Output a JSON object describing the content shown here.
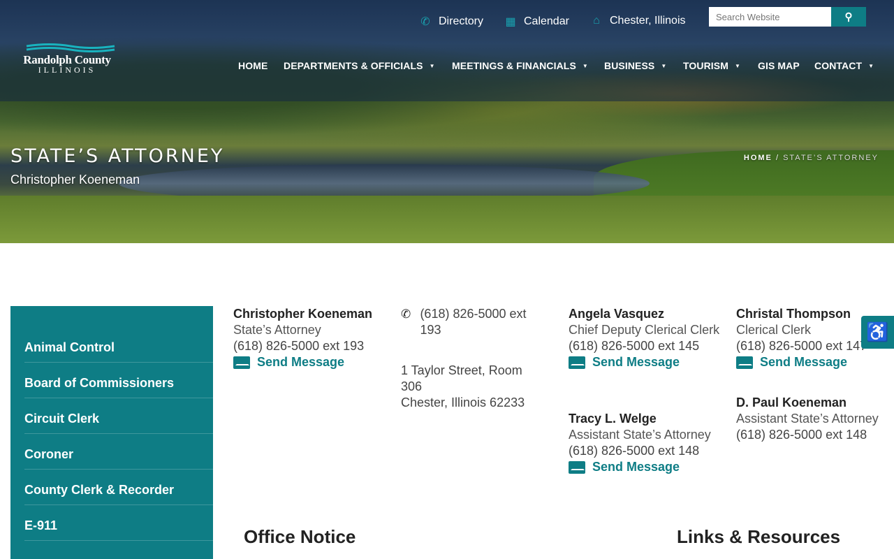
{
  "logo": {
    "name": "Randolph County",
    "state": "ILLINOIS"
  },
  "utility": [
    {
      "icon": "phone-icon",
      "glyph": "📞",
      "label": "Directory"
    },
    {
      "icon": "calendar-icon",
      "glyph": "▦",
      "label": "Calendar"
    },
    {
      "icon": "courthouse-icon",
      "glyph": "⌂",
      "label": "Chester, Illinois"
    }
  ],
  "search": {
    "placeholder": "Search Website",
    "button_icon": "search-icon"
  },
  "menu": [
    {
      "label": "HOME",
      "dropdown": false
    },
    {
      "label": "DEPARTMENTS & OFFICIALS",
      "dropdown": true
    },
    {
      "label": "MEETINGS & FINANCIALS",
      "dropdown": true
    },
    {
      "label": "BUSINESS",
      "dropdown": true
    },
    {
      "label": "TOURISM",
      "dropdown": true
    },
    {
      "label": "GIS MAP",
      "dropdown": false
    },
    {
      "label": "CONTACT",
      "dropdown": true
    }
  ],
  "page": {
    "title": "STATE’S ATTORNEY",
    "subtitle": "Christopher Koeneman"
  },
  "breadcrumb": {
    "home": "HOME",
    "sep": "/",
    "current": "STATE’S ATTORNEY"
  },
  "sidebar": [
    "Animal Control",
    "Board of Commissioners",
    "Circuit Clerk",
    "Coroner",
    "County Clerk & Recorder",
    "E-911"
  ],
  "contact": {
    "phone": "(618) 826-5000 ext 193",
    "address1": "1 Taylor Street, Room 306",
    "address2": "Chester, Illinois 62233"
  },
  "staff": {
    "koeneman": {
      "name": "Christopher Koeneman",
      "role": "State’s Attorney",
      "phone": "(618) 826-5000 ext 193",
      "send": "Send Message"
    },
    "vasquez": {
      "name": "Angela Vasquez",
      "role": "Chief Deputy Clerical Clerk",
      "phone": "(618) 826-5000 ext 145",
      "send": "Send Message"
    },
    "welge": {
      "name": "Tracy L. Welge",
      "role": "Assistant State’s Attorney",
      "phone": "(618) 826-5000 ext 148",
      "send": "Send Message"
    },
    "thompson": {
      "name": "Christal Thompson",
      "role": "Clerical Clerk",
      "phone": "(618) 826-5000 ext 147",
      "send": "Send Message"
    },
    "dpaul": {
      "name": "D. Paul Koeneman",
      "role": "Assistant State’s Attorney",
      "phone": "(618) 826-5000 ext 148"
    }
  },
  "sections": {
    "notice": "Office Notice",
    "links": "Links & Resources"
  },
  "accessibility": {
    "icon": "accessibility-icon"
  },
  "colors": {
    "accent": "#0e7d85",
    "icon_teal": "#19a3b0"
  }
}
